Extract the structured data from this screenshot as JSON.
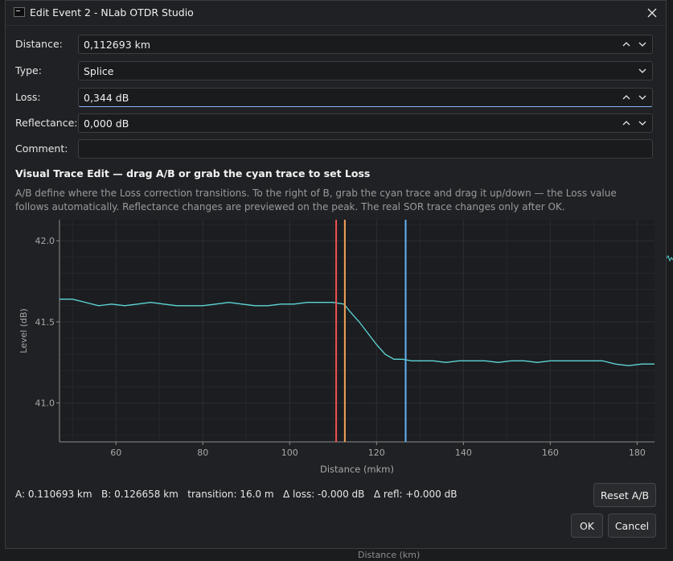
{
  "window": {
    "title": "Edit Event 2 - NLab OTDR Studio"
  },
  "form": {
    "distance": {
      "label": "Distance:",
      "value": "0,112693 km"
    },
    "type": {
      "label": "Type:",
      "value": "Splice"
    },
    "loss": {
      "label": "Loss:",
      "value": "0,344 dB"
    },
    "reflectance": {
      "label": "Reflectance:",
      "value": "0,000 dB"
    },
    "comment": {
      "label": "Comment:",
      "value": ""
    }
  },
  "visual_edit": {
    "heading": "Visual Trace Edit — drag A/B or grab the cyan trace to set Loss",
    "help": "A/B define where the Loss correction transitions. To the right of B, grab the cyan trace and drag it up/down — the Loss value follows automatically. Reflectance changes are previewed on the peak. The real SOR trace changes only after OK."
  },
  "status": {
    "a": "A: 0.110693 km",
    "b": "B: 0.126658 km",
    "transition": "transition: 16.0 m",
    "dloss": "Δ loss: -0.000 dB",
    "drefl": "Δ refl: +0.000 dB"
  },
  "buttons": {
    "reset": "Reset A/B",
    "ok": "OK",
    "cancel": "Cancel"
  },
  "backdrop": {
    "axis_label": "Distance (km)"
  },
  "colors": {
    "trace": "#5cd6d6",
    "marker_a": "#ef5350",
    "marker_event": "#f4a259",
    "marker_b": "#64b5f6",
    "grid": "#2a2c30"
  },
  "chart_data": {
    "type": "line",
    "xlabel": "Distance (mkm)",
    "ylabel": "Level (dB)",
    "xlim": [
      47,
      184
    ],
    "ylim": [
      40.76,
      42.13
    ],
    "xticks": [
      60,
      80,
      100,
      120,
      140,
      160,
      180
    ],
    "yticks": [
      41.0,
      41.5,
      42.0
    ],
    "grid": true,
    "markers": [
      {
        "name": "A",
        "x": 110.7,
        "color": "#ef5350"
      },
      {
        "name": "event",
        "x": 112.7,
        "color": "#f4a259"
      },
      {
        "name": "B",
        "x": 126.7,
        "color": "#64b5f6"
      }
    ],
    "series": [
      {
        "color": "#5cd6d6",
        "x": [
          47,
          50,
          53,
          56,
          59,
          62,
          65,
          68,
          71,
          74,
          77,
          80,
          83,
          86,
          89,
          92,
          95,
          98,
          101,
          104,
          107,
          110,
          112.5,
          114,
          116,
          118,
          120,
          122,
          124,
          126,
          128,
          130,
          133,
          136,
          139,
          142,
          145,
          148,
          151,
          154,
          157,
          160,
          163,
          166,
          169,
          172,
          175,
          178,
          181,
          184
        ],
        "y": [
          41.64,
          41.64,
          41.62,
          41.6,
          41.61,
          41.6,
          41.61,
          41.62,
          41.61,
          41.6,
          41.6,
          41.6,
          41.61,
          41.62,
          41.61,
          41.6,
          41.6,
          41.61,
          41.61,
          41.62,
          41.62,
          41.62,
          41.61,
          41.56,
          41.5,
          41.43,
          41.36,
          41.3,
          41.27,
          41.27,
          41.26,
          41.26,
          41.26,
          41.25,
          41.26,
          41.26,
          41.26,
          41.25,
          41.26,
          41.26,
          41.25,
          41.26,
          41.26,
          41.26,
          41.26,
          41.26,
          41.24,
          41.23,
          41.24,
          41.24
        ]
      }
    ]
  }
}
